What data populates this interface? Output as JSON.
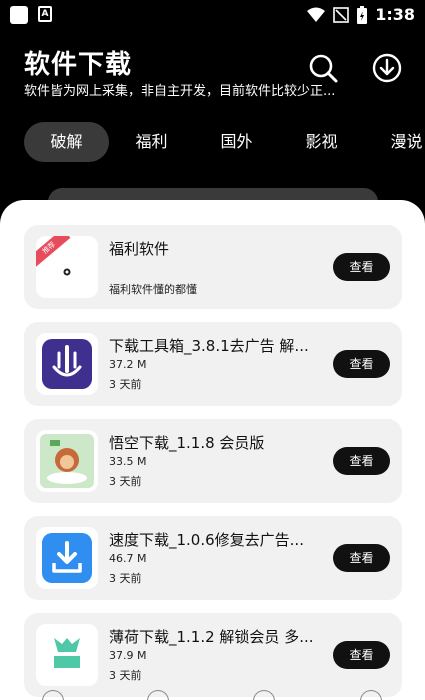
{
  "status_bar": {
    "time": "1:38"
  },
  "header": {
    "title": "软件下载",
    "subtitle": "软件皆为网上采集，非自主开发，目前软件比较少正..."
  },
  "tabs": [
    {
      "label": "破解",
      "active": true
    },
    {
      "label": "福利",
      "active": false
    },
    {
      "label": "国外",
      "active": false
    },
    {
      "label": "影视",
      "active": false
    },
    {
      "label": "漫说",
      "active": false
    }
  ],
  "apps": [
    {
      "name": "福利软件",
      "desc": "福利软件懂的都懂",
      "size": "",
      "date": "",
      "badge": "推荐",
      "button": "查看",
      "icon": "welfare-app-icon"
    },
    {
      "name": "下载工具箱_3.8.1去广告 解...",
      "size": "37.2 M",
      "date": "3 天前",
      "button": "查看",
      "icon": "download-toolbox-icon"
    },
    {
      "name": "悟空下载_1.1.8 会员版",
      "size": "33.5 M",
      "date": "3 天前",
      "button": "查看",
      "icon": "wukong-download-icon"
    },
    {
      "name": "速度下载_1.0.6修复去广告...",
      "size": "46.7 M",
      "date": "3 天前",
      "button": "查看",
      "icon": "speed-download-icon"
    },
    {
      "name": "薄荷下载_1.1.2 解锁会员 多...",
      "size": "37.9 M",
      "date": "3 天前",
      "button": "查看",
      "icon": "mint-download-icon"
    }
  ],
  "colors": {
    "accent_purple": "#3f2f8f",
    "accent_blue": "#2f8ef0",
    "accent_green": "#4fc8a8",
    "badge_red": "#e84b5b"
  }
}
